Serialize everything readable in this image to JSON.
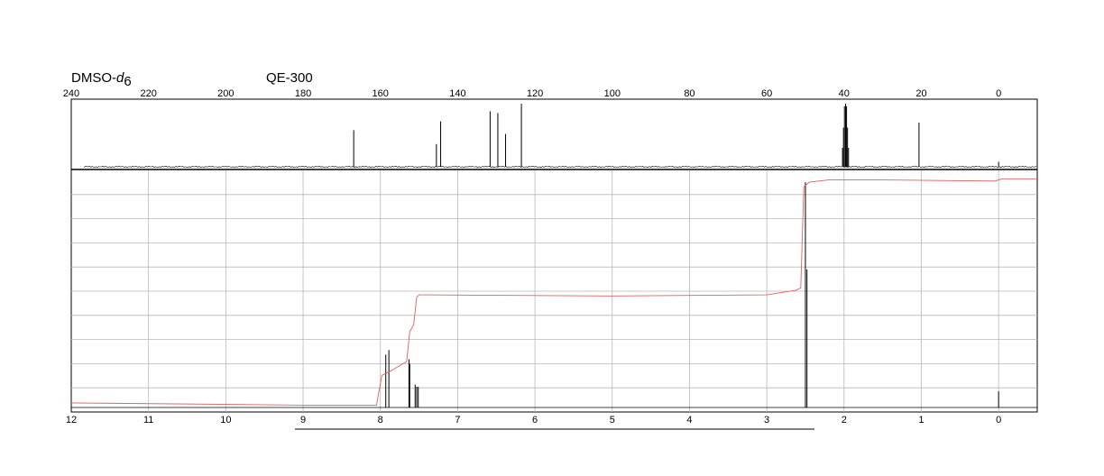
{
  "header": {
    "solvent_prefix": "DMSO-",
    "solvent_italic": "d",
    "solvent_subscript": "6",
    "instrument": "QE-300"
  },
  "colors": {
    "spectrum": "#000000",
    "integral": "#e06060",
    "grid": "#b8b8b8",
    "frame": "#000000"
  },
  "chart_data": [
    {
      "type": "line",
      "spectrum": "13C NMR",
      "xlim": [
        240,
        -10
      ],
      "x_reversed": true,
      "x_ticks": [
        240,
        220,
        200,
        180,
        160,
        140,
        120,
        100,
        80,
        60,
        40,
        20,
        0
      ],
      "x_tick_labels": [
        "240",
        "220",
        "200",
        "180",
        "160",
        "140",
        "120",
        "100",
        "80",
        "60",
        "40",
        "20",
        "0"
      ],
      "ylim": [
        0,
        1
      ],
      "grid": false,
      "peaks": [
        {
          "ppm": 166.9,
          "height": 0.58
        },
        {
          "ppm": 145.5,
          "height": 0.36
        },
        {
          "ppm": 144.4,
          "height": 0.72
        },
        {
          "ppm": 131.6,
          "height": 0.88
        },
        {
          "ppm": 129.6,
          "height": 0.85
        },
        {
          "ppm": 127.6,
          "height": 0.52
        },
        {
          "ppm": 123.5,
          "height": 1.0
        }
      ],
      "solvent_multiplet": [
        {
          "ppm": 40.4,
          "height": 0.3
        },
        {
          "ppm": 40.15,
          "height": 0.62
        },
        {
          "ppm": 39.9,
          "height": 0.96
        },
        {
          "ppm": 39.6,
          "height": 1.0
        },
        {
          "ppm": 39.35,
          "height": 0.96
        },
        {
          "ppm": 39.1,
          "height": 0.62
        },
        {
          "ppm": 38.85,
          "height": 0.3
        }
      ],
      "reference_peaks": [
        {
          "ppm": 20.6,
          "height": 0.7
        },
        {
          "ppm": 0.0,
          "height": 0.08
        }
      ]
    },
    {
      "type": "line",
      "spectrum": "1H NMR",
      "xlim": [
        12,
        -0.5
      ],
      "x_reversed": true,
      "x_ticks": [
        12,
        11,
        10,
        9,
        8,
        7,
        6,
        5,
        4,
        3,
        2,
        1,
        0
      ],
      "x_tick_labels": [
        "12",
        "11",
        "10",
        "9",
        "8",
        "7",
        "6",
        "5",
        "4",
        "3",
        "2",
        "1",
        "0"
      ],
      "ylim": [
        0,
        1
      ],
      "grid": true,
      "peaks": [
        {
          "ppm": 7.93,
          "height": 0.23
        },
        {
          "ppm": 7.89,
          "height": 0.25
        },
        {
          "ppm": 7.63,
          "height": 0.21
        },
        {
          "ppm": 7.62,
          "height": 0.19
        },
        {
          "ppm": 7.55,
          "height": 0.1
        },
        {
          "ppm": 7.53,
          "height": 0.09
        },
        {
          "ppm": 7.51,
          "height": 0.09
        },
        {
          "ppm": 2.5,
          "height": 0.98
        },
        {
          "ppm": 2.48,
          "height": 0.6
        },
        {
          "ppm": 0.0,
          "height": 0.07
        }
      ],
      "integral_curve": [
        [
          12.0,
          0.02
        ],
        [
          9.0,
          0.01
        ],
        [
          8.05,
          0.01
        ],
        [
          7.98,
          0.14
        ],
        [
          7.86,
          0.16
        ],
        [
          7.66,
          0.2
        ],
        [
          7.62,
          0.33
        ],
        [
          7.57,
          0.36
        ],
        [
          7.53,
          0.48
        ],
        [
          7.5,
          0.49
        ],
        [
          7.4,
          0.49
        ],
        [
          5.0,
          0.485
        ],
        [
          3.0,
          0.49
        ],
        [
          2.62,
          0.51
        ],
        [
          2.56,
          0.52
        ],
        [
          2.52,
          0.96
        ],
        [
          2.45,
          0.98
        ],
        [
          2.2,
          0.99
        ],
        [
          1.5,
          0.99
        ],
        [
          0.05,
          0.985
        ],
        [
          -0.05,
          0.995
        ],
        [
          -0.5,
          0.995
        ]
      ]
    }
  ]
}
